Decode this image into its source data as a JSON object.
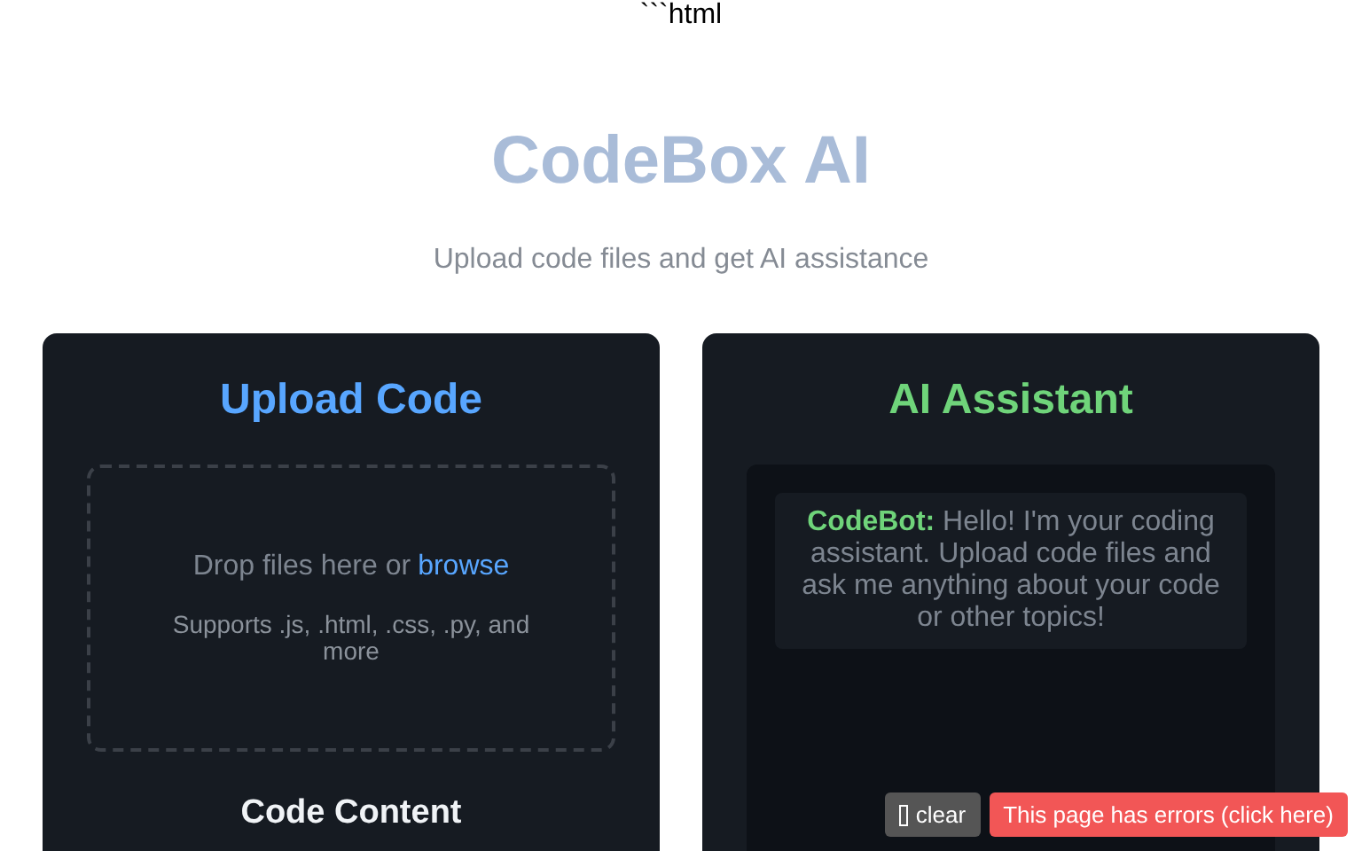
{
  "stray_text": "```html",
  "header": {
    "title": "CodeBox AI",
    "subtitle": "Upload code files and get AI assistance"
  },
  "upload_panel": {
    "title": "Upload Code",
    "drop_text": "Drop files here or",
    "browse_link": "browse",
    "supports": "Supports .js, .html, .css, .py, and more",
    "section_title": "Code Content"
  },
  "assistant_panel": {
    "title": "AI Assistant",
    "messages": [
      {
        "sender": "CodeBot:",
        "text": "Hello! I'm your coding assistant. Upload code files and ask me anything about your code or other topics!"
      }
    ]
  },
  "overlay": {
    "clear_button": "clear",
    "error_button": "This page has errors (click here)"
  }
}
